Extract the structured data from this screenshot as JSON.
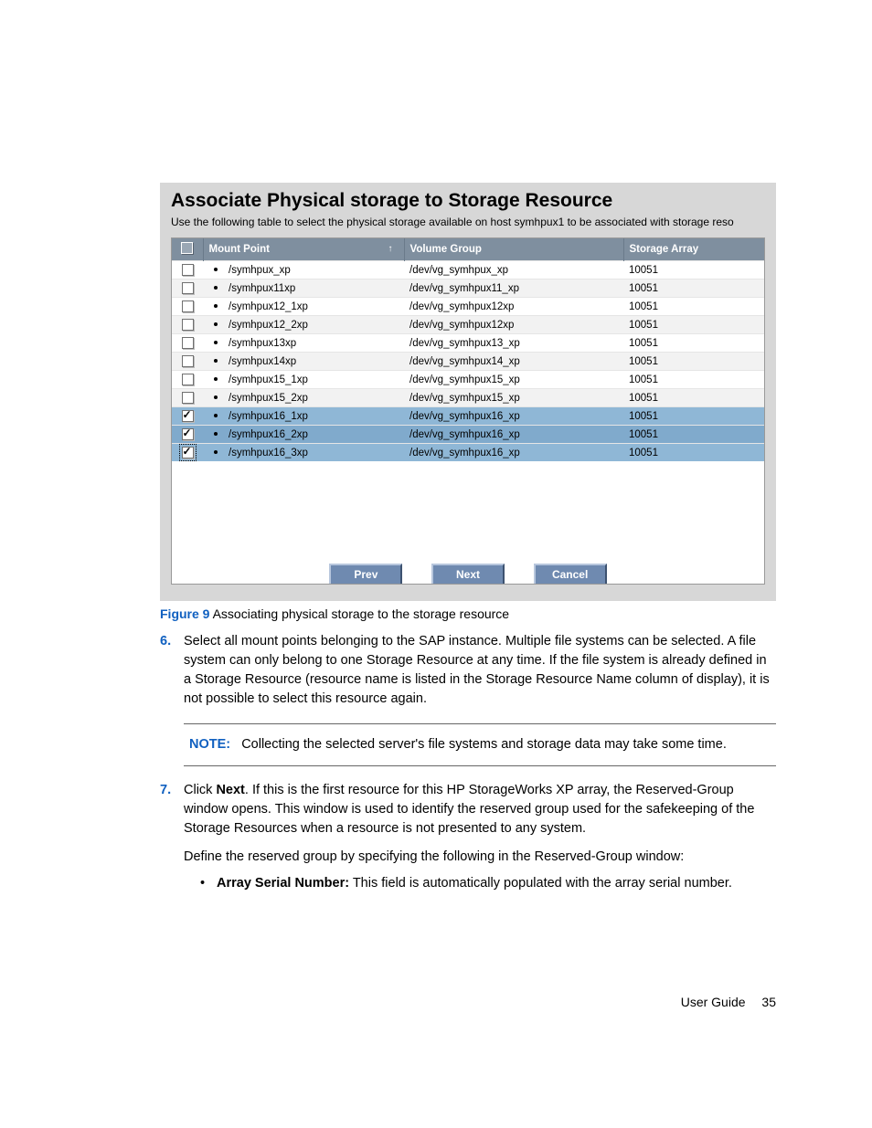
{
  "screenshot": {
    "title": "Associate Physical storage to Storage Resource",
    "subtitle": "Use the following table to select the physical storage available on host symhpux1 to be associated with storage reso",
    "headers": {
      "mount_point": "Mount Point",
      "volume_group": "Volume Group",
      "storage_array": "Storage Array"
    },
    "rows": [
      {
        "checked": false,
        "focused": false,
        "mount": "/symhpux_xp",
        "vg": "/dev/vg_symhpux_xp",
        "array": "10051",
        "sel": false
      },
      {
        "checked": false,
        "focused": false,
        "mount": "/symhpux11xp",
        "vg": "/dev/vg_symhpux11_xp",
        "array": "10051",
        "sel": false
      },
      {
        "checked": false,
        "focused": false,
        "mount": "/symhpux12_1xp",
        "vg": "/dev/vg_symhpux12xp",
        "array": "10051",
        "sel": false
      },
      {
        "checked": false,
        "focused": false,
        "mount": "/symhpux12_2xp",
        "vg": "/dev/vg_symhpux12xp",
        "array": "10051",
        "sel": false
      },
      {
        "checked": false,
        "focused": false,
        "mount": "/symhpux13xp",
        "vg": "/dev/vg_symhpux13_xp",
        "array": "10051",
        "sel": false
      },
      {
        "checked": false,
        "focused": false,
        "mount": "/symhpux14xp",
        "vg": "/dev/vg_symhpux14_xp",
        "array": "10051",
        "sel": false
      },
      {
        "checked": false,
        "focused": false,
        "mount": "/symhpux15_1xp",
        "vg": "/dev/vg_symhpux15_xp",
        "array": "10051",
        "sel": false
      },
      {
        "checked": false,
        "focused": false,
        "mount": "/symhpux15_2xp",
        "vg": "/dev/vg_symhpux15_xp",
        "array": "10051",
        "sel": false
      },
      {
        "checked": true,
        "focused": false,
        "mount": "/symhpux16_1xp",
        "vg": "/dev/vg_symhpux16_xp",
        "array": "10051",
        "sel": true
      },
      {
        "checked": true,
        "focused": false,
        "mount": "/symhpux16_2xp",
        "vg": "/dev/vg_symhpux16_xp",
        "array": "10051",
        "sel": true
      },
      {
        "checked": true,
        "focused": true,
        "mount": "/symhpux16_3xp",
        "vg": "/dev/vg_symhpux16_xp",
        "array": "10051",
        "sel": true
      }
    ],
    "buttons": {
      "prev": "Prev",
      "next": "Next",
      "cancel": "Cancel"
    }
  },
  "caption": {
    "label": "Figure 9",
    "text": " Associating physical storage to the storage resource"
  },
  "step6": {
    "num": "6.",
    "text": "Select all mount points belonging to the SAP instance. Multiple file systems can be selected. A file system can only belong to one Storage Resource at any time. If the file system is already defined in a Storage Resource (resource name is listed in the Storage Resource Name column of display), it is not possible to select this resource again."
  },
  "note": {
    "label": "NOTE:",
    "text": "Collecting the selected server's file systems and storage data may take some time."
  },
  "step7": {
    "num": "7.",
    "lead": "Click ",
    "bold": "Next",
    "rest": ". If this is the first resource for this HP StorageWorks XP array, the Reserved-Group window opens. This window is used to identify the reserved group used for the safekeeping of the Storage Resources when a resource is not presented to any system.",
    "define": "Define the reserved group by specifying the following in the Reserved-Group window:",
    "bullet_bold": "Array Serial Number:",
    "bullet_rest": " This field is automatically populated with the array serial number."
  },
  "footer": {
    "title": "User Guide",
    "page": "35"
  }
}
